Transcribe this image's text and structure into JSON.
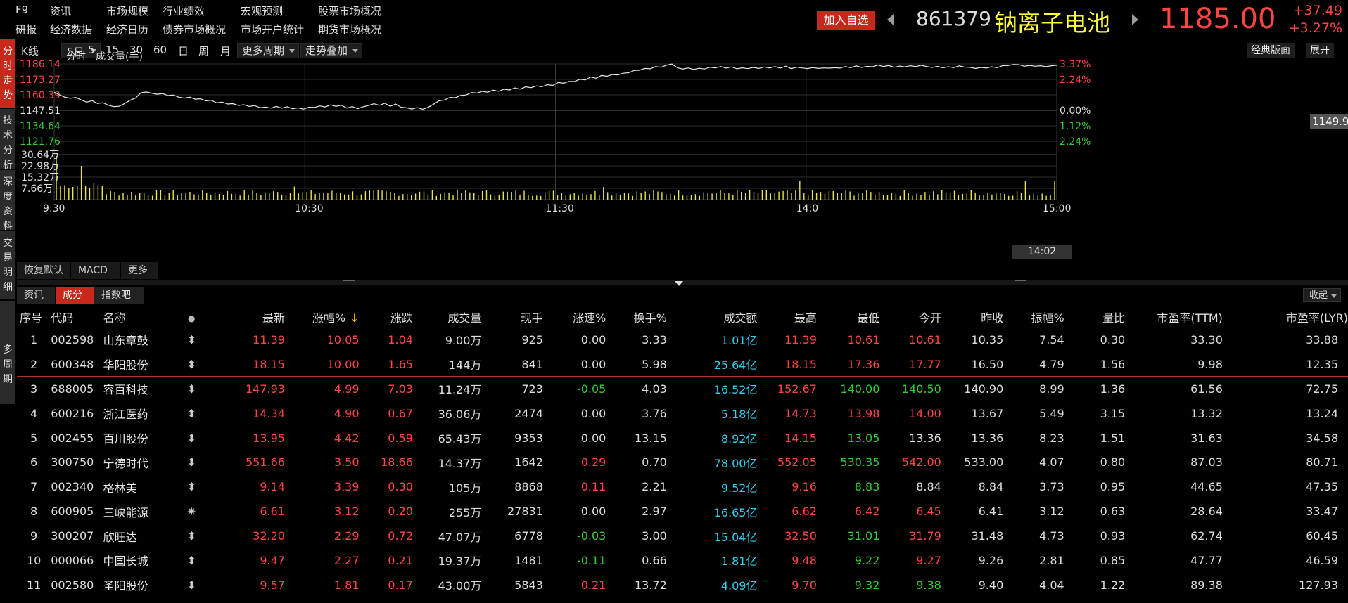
{
  "nav": {
    "row1": [
      "F9",
      "资讯",
      "市场规模",
      "行业绩效",
      "宏观预测",
      "股票市场概况"
    ],
    "row2": [
      "研报",
      "经济数据",
      "经济日历",
      "债券市场概况",
      "市场开户统计",
      "期货市场概况"
    ]
  },
  "quote": {
    "add_fav": "加入自选",
    "code": "861379",
    "name": "钠离子电池",
    "price": "1185.00",
    "change": "+37.49",
    "change_pct": "+3.27%"
  },
  "sidebar": [
    {
      "label": "分时走势",
      "active": true
    },
    {
      "label": "技术分析",
      "active": false
    },
    {
      "label": "深度资料",
      "active": false
    },
    {
      "label": "交易明细",
      "active": false
    },
    {
      "label": "多周期",
      "active": false
    }
  ],
  "toolbar": {
    "kline": "K线",
    "period_5d": "5日",
    "periods": [
      "5",
      "15",
      "30",
      "60",
      "日",
      "周",
      "月"
    ],
    "more_period": "更多周期",
    "trend_overlay": "走势叠加",
    "classic": "经典版面",
    "expand": "展开"
  },
  "chart_legend": {
    "intraday": "分时",
    "volume": "成交量(手)"
  },
  "chart_data": {
    "type": "line",
    "price_axis_left": [
      "1186.14",
      "1173.27",
      "1160.39",
      "1147.51",
      "1134.64",
      "1121.76"
    ],
    "price_axis_right": [
      "3.37%",
      "2.24%",
      "",
      "0.00%",
      "1.12%",
      "2.24%"
    ],
    "price_axis_colors": [
      "#ff4444",
      "#ff4444",
      "#ff4444",
      "#dcdcdc",
      "#33cc33",
      "#33cc33"
    ],
    "volume_axis": [
      "30.64万",
      "22.98万",
      "15.32万",
      "7.66万"
    ],
    "time_labels": [
      "9:30",
      "10:30",
      "11:30",
      "14:0",
      "15:00"
    ],
    "ylim": [
      1121.76,
      1186.14
    ],
    "last_price_tag": "1149.90",
    "hover_time": "14:02",
    "price_points": [
      1162.5,
      1160.4,
      1158.4,
      1157.5,
      1158.2,
      1156.2,
      1154.3,
      1155.6,
      1153.2,
      1153.9,
      1151.8,
      1150.6,
      1150.9,
      1153.2,
      1155.9,
      1157.7,
      1162.1,
      1162.8,
      1161.8,
      1160.9,
      1161.5,
      1159.8,
      1160.3,
      1158.4,
      1157.7,
      1158.5,
      1156.8,
      1157.1,
      1155.4,
      1155.9,
      1153.7,
      1154.4,
      1152.8,
      1153.1,
      1151.6,
      1152.2,
      1150.8,
      1151.5,
      1149.7,
      1150.2,
      1149.4,
      1150.8,
      1149.3,
      1150.5,
      1148.8,
      1149.6,
      1148.5,
      1150.1,
      1149.9,
      1151.2,
      1150.4,
      1152.1,
      1150.9,
      1151.8,
      1149.4,
      1150.7,
      1148.9,
      1150.5,
      1151.6,
      1153.0,
      1151.7,
      1153.4,
      1150.9,
      1152.8,
      1150.1,
      1149.6,
      1148.6,
      1149.8,
      1148.4,
      1150.0,
      1152.6,
      1155.4,
      1156.1,
      1158.3,
      1158.0,
      1159.9,
      1160.3,
      1162.3,
      1161.9,
      1163.4,
      1162.6,
      1164.3,
      1163.4,
      1165.1,
      1164.4,
      1166.2,
      1165.1,
      1167.1,
      1166.4,
      1167.9,
      1167.2,
      1168.9,
      1168.3,
      1170.7,
      1170.1,
      1171.6,
      1171.5,
      1173.4,
      1172.8,
      1175.3,
      1174.2,
      1176.6,
      1175.9,
      1177.3,
      1177.0,
      1178.4,
      1178.8,
      1180.7,
      1180.9,
      1182.4,
      1182.1,
      1183.9,
      1183.4,
      1185.1,
      1186.0,
      1183.0,
      1181.9,
      1182.8,
      1181.6,
      1182.5,
      1181.9,
      1183.4,
      1182.8,
      1184.0,
      1182.6,
      1183.7,
      1182.1,
      1182.9,
      1182.2,
      1183.2,
      1182.4,
      1183.6,
      1182.8,
      1183.9,
      1182.6,
      1184.3,
      1182.2,
      1183.5,
      1182.8,
      1182.3,
      1183.1,
      1182.4,
      1182.8,
      1182.6,
      1183.0,
      1182.7,
      1183.9,
      1183.0,
      1184.5,
      1183.2,
      1184.1,
      1183.8,
      1185.2,
      1184.0,
      1184.8,
      1183.4,
      1184.3,
      1183.7,
      1184.6,
      1183.9,
      1185.0,
      1184.0,
      1183.2,
      1184.1,
      1182.9,
      1183.8,
      1183.1,
      1184.5,
      1183.5,
      1183.3,
      1182.4,
      1183.2,
      1182.7,
      1183.8,
      1183.0,
      1184.7,
      1184.8,
      1185.6,
      1185.5,
      1184.2,
      1184.9,
      1184.2,
      1184.6,
      1183.9,
      1184.6,
      1185.0
    ]
  },
  "indicator_tabs": [
    "恢复默认",
    "MACD",
    "更多"
  ],
  "bottom_tabs": [
    {
      "label": "资讯",
      "active": false
    },
    {
      "label": "成分",
      "active": true
    },
    {
      "label": "指数吧",
      "active": false
    }
  ],
  "collapse": "收起",
  "table": {
    "headers": [
      "序号",
      "代码",
      "名称",
      "",
      "最新",
      "涨幅%",
      "涨跌",
      "成交量",
      "现手",
      "涨速%",
      "换手%",
      "成交额",
      "最高",
      "最低",
      "今开",
      "昨收",
      "振幅%",
      "量比",
      "市盈率(TTM)",
      "市盈率(LYR)"
    ],
    "sort_indicator": "↓",
    "rows": [
      [
        "1",
        "002598",
        "山东章鼓",
        "⬍",
        "11.39",
        "10.05",
        "1.04",
        "9.00万",
        "925",
        "0.00",
        "3.33",
        "1.01亿",
        "11.39",
        "10.61",
        "10.61",
        "10.35",
        "7.54",
        "0.30",
        "33.30",
        "33.88"
      ],
      [
        "2",
        "600348",
        "华阳股份",
        "⬍",
        "18.15",
        "10.00",
        "1.65",
        "144万",
        "841",
        "0.00",
        "5.98",
        "25.64亿",
        "18.15",
        "17.36",
        "17.77",
        "16.50",
        "4.79",
        "1.56",
        "9.98",
        "12.35"
      ],
      [
        "3",
        "688005",
        "容百科技",
        "⬍",
        "147.93",
        "4.99",
        "7.03",
        "11.24万",
        "723",
        "-0.05",
        "4.03",
        "16.52亿",
        "152.67",
        "140.00",
        "140.50",
        "140.90",
        "8.99",
        "1.36",
        "61.56",
        "72.75"
      ],
      [
        "4",
        "600216",
        "浙江医药",
        "⬍",
        "14.34",
        "4.90",
        "0.67",
        "36.06万",
        "2474",
        "0.00",
        "3.76",
        "5.18亿",
        "14.73",
        "13.98",
        "14.00",
        "13.67",
        "5.49",
        "3.15",
        "13.32",
        "13.24"
      ],
      [
        "5",
        "002455",
        "百川股份",
        "⬍",
        "13.95",
        "4.42",
        "0.59",
        "65.43万",
        "9353",
        "0.00",
        "13.15",
        "8.92亿",
        "14.15",
        "13.05",
        "13.36",
        "13.36",
        "8.23",
        "1.51",
        "31.63",
        "34.58"
      ],
      [
        "6",
        "300750",
        "宁德时代",
        "⬍",
        "551.66",
        "3.50",
        "18.66",
        "14.37万",
        "1642",
        "0.29",
        "0.70",
        "78.00亿",
        "552.05",
        "530.35",
        "542.00",
        "533.00",
        "4.07",
        "0.80",
        "87.03",
        "80.71"
      ],
      [
        "7",
        "002340",
        "格林美",
        "⬍",
        "9.14",
        "3.39",
        "0.30",
        "105万",
        "8868",
        "0.11",
        "2.21",
        "9.52亿",
        "9.16",
        "8.83",
        "8.84",
        "8.84",
        "3.73",
        "0.95",
        "44.65",
        "47.35"
      ],
      [
        "8",
        "600905",
        "三峡能源",
        "✷",
        "6.61",
        "3.12",
        "0.20",
        "255万",
        "27831",
        "0.00",
        "2.97",
        "16.65亿",
        "6.62",
        "6.42",
        "6.45",
        "6.41",
        "3.12",
        "0.63",
        "28.64",
        "33.47"
      ],
      [
        "9",
        "300207",
        "欣旺达",
        "⬍",
        "32.20",
        "2.29",
        "0.72",
        "47.07万",
        "6778",
        "-0.03",
        "3.00",
        "15.04亿",
        "32.50",
        "31.01",
        "31.79",
        "31.48",
        "4.73",
        "0.93",
        "62.74",
        "60.45"
      ],
      [
        "10",
        "000066",
        "中国长城",
        "⬍",
        "9.47",
        "2.27",
        "0.21",
        "19.37万",
        "1481",
        "-0.11",
        "0.66",
        "1.81亿",
        "9.48",
        "9.22",
        "9.27",
        "9.26",
        "2.81",
        "0.85",
        "47.77",
        "46.59"
      ],
      [
        "11",
        "002580",
        "圣阳股份",
        "⬍",
        "9.57",
        "1.81",
        "0.17",
        "43.00万",
        "5843",
        "0.21",
        "13.72",
        "4.09亿",
        "9.70",
        "9.32",
        "9.38",
        "9.40",
        "4.04",
        "1.22",
        "89.38",
        "127.93"
      ]
    ]
  }
}
